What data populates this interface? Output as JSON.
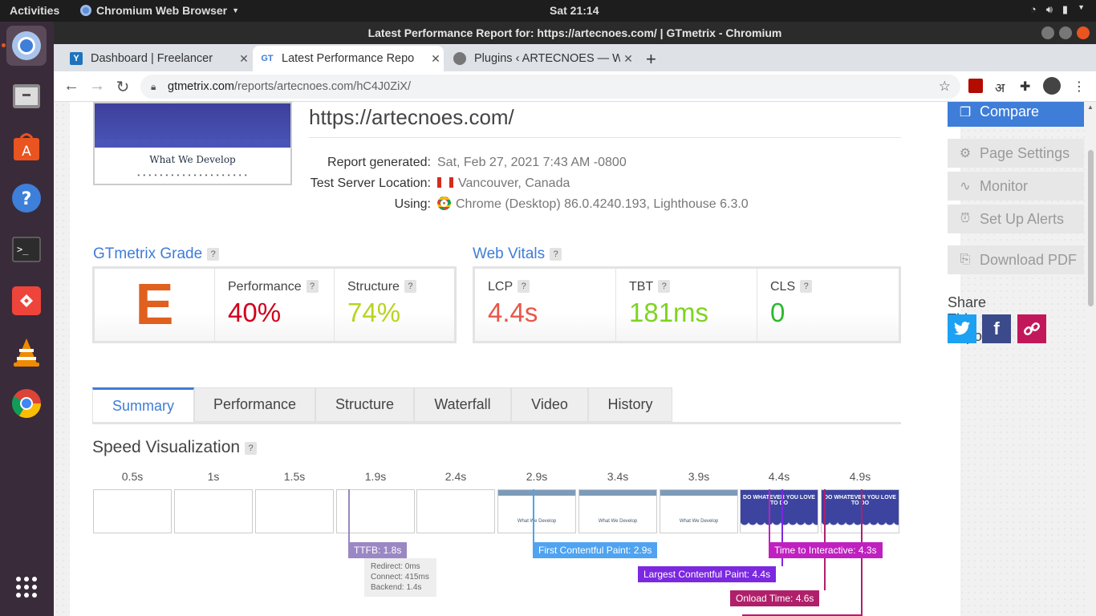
{
  "desktop": {
    "activities": "Activities",
    "app_name": "Chromium Web Browser",
    "clock": "Sat 21:14"
  },
  "window": {
    "title": "Latest Performance Report for: https://artecnoes.com/ | GTmetrix - Chromium"
  },
  "tabs": [
    {
      "label": "Dashboard | Freelancer",
      "favicon": "Y"
    },
    {
      "label": "Latest Performance Repo",
      "favicon": "GT"
    },
    {
      "label": "Plugins ‹ ARTECNOES — W",
      "favicon": ""
    }
  ],
  "address": {
    "host": "gtmetrix.com",
    "path": "/reports/artecnoes.com/hC4J0ZiX/"
  },
  "thumbnail": {
    "heading": "What We Develop"
  },
  "report": {
    "url": "https://artecnoes.com/",
    "generated_label": "Report generated:",
    "generated_value": "Sat, Feb 27, 2021 7:43 AM -0800",
    "location_label": "Test Server Location:",
    "location_value": "Vancouver, Canada",
    "using_label": "Using:",
    "using_value": "Chrome (Desktop) 86.0.4240.193, Lighthouse 6.3.0"
  },
  "grade": {
    "title": "GTmetrix Grade",
    "help": "?",
    "letter": "E",
    "performance_label": "Performance",
    "performance_value": "40%",
    "structure_label": "Structure",
    "structure_value": "74%"
  },
  "vitals": {
    "title": "Web Vitals",
    "help": "?",
    "lcp_label": "LCP",
    "lcp_value": "4.4s",
    "tbt_label": "TBT",
    "tbt_value": "181ms",
    "cls_label": "CLS",
    "cls_value": "0"
  },
  "report_tabs": [
    "Summary",
    "Performance",
    "Structure",
    "Waterfall",
    "Video",
    "History"
  ],
  "speed": {
    "title": "Speed Visualization",
    "help": "?",
    "times": [
      "0.5s",
      "1s",
      "1.5s",
      "1.9s",
      "2.4s",
      "2.9s",
      "3.4s",
      "3.9s",
      "4.4s",
      "4.9s"
    ],
    "frame_caption": "What We Develop",
    "frame_dark_caption": "DO WHATEVER YOU LOVE TO DO",
    "markers": {
      "ttfb": "TTFB: 1.8s",
      "redirect": "Redirect: 0ms",
      "connect": "Connect: 415ms",
      "backend": "Backend: 1.4s",
      "fcp": "First Contentful Paint: 2.9s",
      "tti": "Time to Interactive: 4.3s",
      "lcp": "Largest Contentful Paint: 4.4s",
      "onload": "Onload Time: 4.6s"
    }
  },
  "sidebar": {
    "compare": "Compare",
    "page_settings": "Page Settings",
    "monitor": "Monitor",
    "alerts": "Set Up Alerts",
    "pdf": "Download PDF",
    "share_title": "Share This Report"
  },
  "colors": {
    "accent": "#3e7dd8",
    "grade_e": "#e06020",
    "performance": "#d0021b",
    "structure": "#b8d41e",
    "lcp": "#e8574a",
    "tbt": "#7ed321",
    "cls": "#2eb82e",
    "ttfb": "#9b87c4",
    "fcp": "#4fa3f0",
    "lcp_marker": "#7b28e0",
    "tti": "#c020c0",
    "onload": "#b0206a"
  }
}
